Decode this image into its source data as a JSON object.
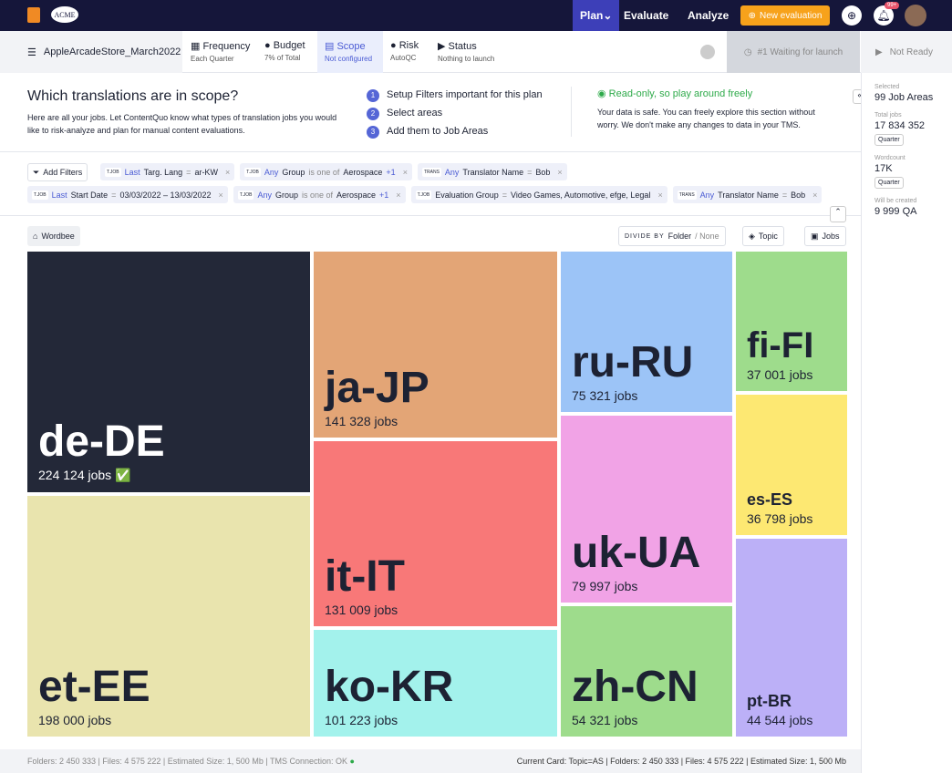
{
  "topbar": {
    "brand": "ACME",
    "nav": [
      "Plan",
      "Evaluate",
      "Analyze"
    ],
    "new_evaluation": "New evaluation",
    "notifications": "99+"
  },
  "subheader": {
    "project": "AppleArcadeStore_March2022",
    "steps": [
      {
        "label": "Frequency",
        "sub": "Each Quarter"
      },
      {
        "label": "Budget",
        "sub": "7% of Total"
      },
      {
        "label": "Scope",
        "sub": "Not configured"
      },
      {
        "label": "Risk",
        "sub": "AutoQC"
      },
      {
        "label": "Status",
        "sub": "Nothing to launch"
      }
    ],
    "waiting": "#1 Waiting for launch",
    "not_ready": "Not Ready"
  },
  "intro": {
    "title": "Which translations are in scope?",
    "desc": "Here are all your jobs. Let ContentQuo know what types of translation jobs you would like to risk-analyze and plan for manual content evaluations.",
    "steps": [
      "Setup Filters important for this plan",
      "Select areas",
      "Add them to Job Areas"
    ],
    "readonly_title": "Read-only, so play around freely",
    "readonly_desc": "Your data is safe. You can freely explore this section without worry. We don't make any changes to data in your TMS."
  },
  "filters": {
    "add": "Add Filters",
    "row1": [
      {
        "tag": "T.JOB",
        "q": "Last",
        "field": "Targ. Lang",
        "op": "=",
        "val": "ar-KW"
      },
      {
        "tag": "T.JOB",
        "q": "Any",
        "field": "Group",
        "op": "is one of",
        "val": "Aerospace",
        "extra": "+1"
      },
      {
        "tag": "TRANS",
        "q": "Any",
        "field": "Translator Name",
        "op": "=",
        "val": "Bob"
      }
    ],
    "row2": [
      {
        "tag": "T.JOB",
        "q": "Last",
        "field": "Start Date",
        "op": "=",
        "val": "03/03/2022 – 13/03/2022"
      },
      {
        "tag": "T.JOB",
        "q": "Any",
        "field": "Group",
        "op": "is one of",
        "val": "Aerospace",
        "extra": "+1"
      },
      {
        "tag": "T.JOB",
        "q": "",
        "field": "Evaluation Group",
        "op": "=",
        "val": "Video Games, Automotive, efge, Legal"
      },
      {
        "tag": "TRANS",
        "q": "Any",
        "field": "Translator Name",
        "op": "=",
        "val": "Bob"
      }
    ]
  },
  "toolbar": {
    "crumb": "Wordbee",
    "divide_by": "DIVIDE BY",
    "folder": "Folder",
    "none": "/ None",
    "topic": "Topic",
    "jobs": "Jobs"
  },
  "tiles": [
    {
      "name": "de-DE",
      "count": "224 124 jobs",
      "color": "#232838",
      "check": "✅"
    },
    {
      "name": "et-EE",
      "count": "198 000 jobs",
      "color": "#e9e4ae"
    },
    {
      "name": "ja-JP",
      "count": "141 328 jobs",
      "color": "#e3a576"
    },
    {
      "name": "it-IT",
      "count": "131 009 jobs",
      "color": "#f87878"
    },
    {
      "name": "ko-KR",
      "count": "101 223 jobs",
      "color": "#a3f2ec"
    },
    {
      "name": "ru-RU",
      "count": "75 321 jobs",
      "color": "#9cc4f7"
    },
    {
      "name": "uk-UA",
      "count": "79 997 jobs",
      "color": "#f1a3e6"
    },
    {
      "name": "zh-CN",
      "count": "54 321 jobs",
      "color": "#9edc8c"
    },
    {
      "name": "fi-FI",
      "count": "37 001 jobs",
      "color": "#9edc8c"
    },
    {
      "name": "es-ES",
      "count": "36 798 jobs",
      "color": "#fde872"
    },
    {
      "name": "pt-BR",
      "count": "44 544 jobs",
      "color": "#bcb0f7"
    }
  ],
  "right_panel": {
    "selected_label": "Selected",
    "selected": "99 Job Areas",
    "total_label": "Total jobs",
    "total": "17 834 352",
    "period": "Quarter",
    "wc_label": "Wordcount",
    "wc": "17K",
    "wc_period": "Quarter",
    "created_label": "Will be created",
    "created": "9 999 QA"
  },
  "footer": {
    "left": "Folders: 2 450 333  |  Files: 4 575 222  |  Estimated Size: 1, 500 Mb  |  TMS Connection: OK",
    "right": "Current Card: Topic=AS  |  Folders: 2 450 333  |  Files: 4 575 222  |  Estimated Size: 1, 500 Mb"
  }
}
